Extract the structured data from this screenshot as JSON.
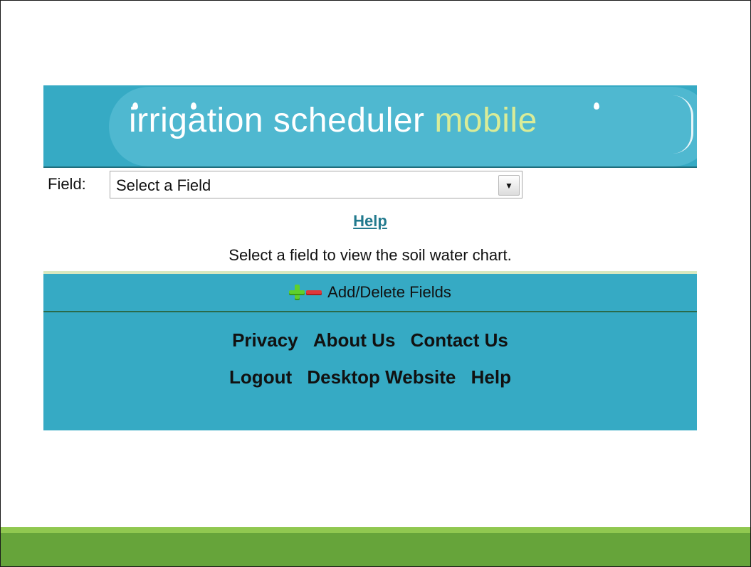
{
  "banner": {
    "title_main": "irrigation scheduler",
    "title_accent": "mobile"
  },
  "field": {
    "label": "Field:",
    "selected": "Select a Field"
  },
  "help_link": "Help",
  "message": "Select a field to view the soil water chart.",
  "add_delete": {
    "label": "Add/Delete Fields",
    "icons": [
      "plus-icon",
      "minus-icon"
    ]
  },
  "footer": {
    "row1": [
      "Privacy",
      "About Us",
      "Contact Us"
    ],
    "row2": [
      "Logout",
      "Desktop Website",
      "Help"
    ]
  },
  "colors": {
    "banner": "#36aac4",
    "accent_text": "#d9ec98",
    "link": "#227a8e",
    "bottom_bar": "#66a43a"
  }
}
